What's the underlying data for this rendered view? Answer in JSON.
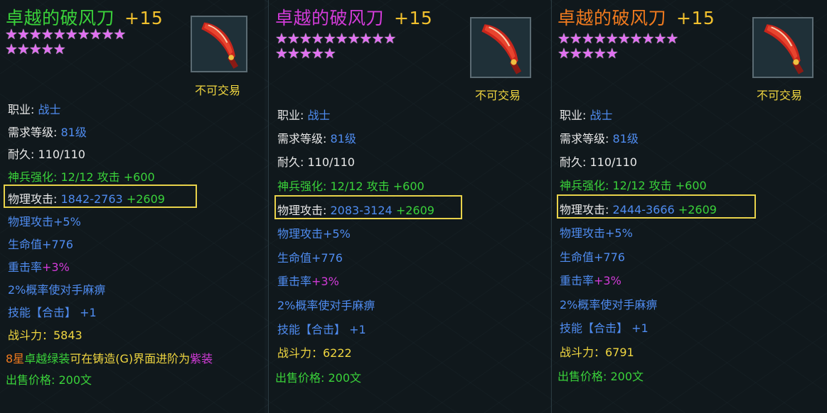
{
  "colors": {
    "background": "#131c21",
    "title_green": "#3ad23a",
    "title_purple": "#d23bd8",
    "title_orange": "#f07a1e",
    "stars": "#e070f0",
    "stat_blue": "#4f8cf0",
    "bonus_green": "#3ad23a",
    "highlight_box": "#e8d24a"
  },
  "panels": [
    {
      "title": "卓越的破风刀",
      "enhance": "+15",
      "title_color": "green",
      "stars_row1": "★★★★★★★★★★",
      "stars_row2": "★★★★★",
      "icon": "red-blade-weapon-icon",
      "untradable": "不可交易",
      "job_label": "职业:",
      "job_value": "战士",
      "level_label": "需求等级:",
      "level_value": "81级",
      "durability_label": "耐久:",
      "durability_value": "110/110",
      "refine": "神兵强化: 12/12  攻击 +600",
      "phys_label": "物理攻击:",
      "phys_value": "1842-2763",
      "phys_bonus": "+2609",
      "bonus_phys": "物理攻击+5%",
      "bonus_hp": "生命值+776",
      "bonus_crit_label": "重击率",
      "bonus_crit_value": "+3%",
      "bonus_stun": "2%概率使对手麻痹",
      "skill_label": "技能【合击】",
      "skill_value": "+1",
      "power": "战斗力：5843",
      "note_part1": "8星",
      "note_part2": "卓越绿装",
      "note_part3": "可在铸造(G)界面进阶为",
      "note_part4": "紫装",
      "sell": "出售价格: 200文"
    },
    {
      "title": "卓越的破风刀",
      "enhance": "+15",
      "title_color": "purple",
      "stars_row1": "★★★★★★★★★★",
      "stars_row2": "★★★★★",
      "icon": "red-blade-weapon-icon",
      "untradable": "不可交易",
      "job_label": "职业:",
      "job_value": "战士",
      "level_label": "需求等级:",
      "level_value": "81级",
      "durability_label": "耐久:",
      "durability_value": "110/110",
      "refine": "神兵强化: 12/12  攻击 +600",
      "phys_label": "物理攻击:",
      "phys_value": "2083-3124",
      "phys_bonus": "+2609",
      "bonus_phys": "物理攻击+5%",
      "bonus_hp": "生命值+776",
      "bonus_crit_label": "重击率",
      "bonus_crit_value": "+3%",
      "bonus_stun": "2%概率使对手麻痹",
      "skill_label": "技能【合击】",
      "skill_value": "+1",
      "power": "战斗力：6222",
      "sell": "出售价格: 200文"
    },
    {
      "title": "卓越的破风刀",
      "enhance": "+15",
      "title_color": "orange",
      "stars_row1": "★★★★★★★★★★",
      "stars_row2": "★★★★★",
      "icon": "red-blade-weapon-icon",
      "untradable": "不可交易",
      "job_label": "职业:",
      "job_value": "战士",
      "level_label": "需求等级:",
      "level_value": "81级",
      "durability_label": "耐久:",
      "durability_value": "110/110",
      "refine": "神兵强化: 12/12  攻击 +600",
      "phys_label": "物理攻击:",
      "phys_value": "2444-3666",
      "phys_bonus": "+2609",
      "bonus_phys": "物理攻击+5%",
      "bonus_hp": "生命值+776",
      "bonus_crit_label": "重击率",
      "bonus_crit_value": "+3%",
      "bonus_stun": "2%概率使对手麻痹",
      "skill_label": "技能【合击】",
      "skill_value": "+1",
      "power": "战斗力：6791",
      "sell": "出售价格: 200文"
    }
  ]
}
